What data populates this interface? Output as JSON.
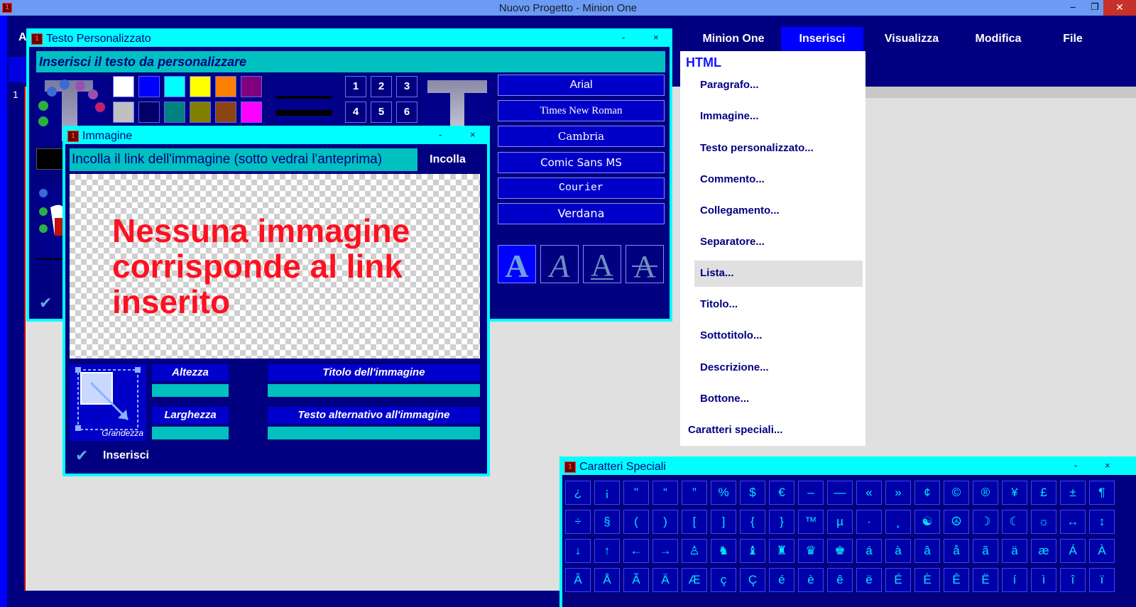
{
  "os_window": {
    "title": "Nuovo Progetto - Minion One",
    "icon_label": "1",
    "minimize": "–",
    "restore": "❐",
    "close": "✕"
  },
  "editor": {
    "top_letter": "A",
    "line_number": "1"
  },
  "menu": {
    "items": [
      "Minion One",
      "Inserisci",
      "Visualizza",
      "Modifica",
      "File"
    ],
    "active": "Inserisci"
  },
  "dropdown": {
    "header": "HTML",
    "items": [
      "Paragrafo...",
      "Immagine...",
      "Testo personalizzato...",
      "Commento...",
      "Collegamento...",
      "Separatore...",
      "Lista...",
      "Titolo...",
      "Sottotitolo...",
      "Descrizione...",
      "Bottone..."
    ],
    "footer": "Caratteri speciali...",
    "highlighted": "Lista..."
  },
  "testo_personalizzato": {
    "title": "Testo Personalizzato",
    "minimize": "-",
    "close": "×",
    "input_placeholder": "Inserisci il testo da personalizzare",
    "colors": [
      "#ffffff",
      "#0000ff",
      "#00ffff",
      "#ffff00",
      "#ff8000",
      "#800080",
      "#c0c0c0",
      "#000066",
      "#008080",
      "#808000",
      "#8b4513",
      "#ff00ff"
    ],
    "numbers": [
      "1",
      "2",
      "3",
      "4",
      "5",
      "6"
    ],
    "fonts": [
      "Arial",
      "Times New Roman",
      "Cambria",
      "Comic Sans MS",
      "Courier",
      "Verdana"
    ],
    "check": "✔"
  },
  "immagine": {
    "title": "Immagine",
    "minimize": "-",
    "close": "×",
    "link_placeholder": "Incolla il link dell'immagine (sotto vedrai l'anteprima)",
    "paste_button": "Incolla",
    "preview_message": "Nessuna immagine corrisponde al link inserito",
    "size_label": "Grandezza",
    "height_label": "Altezza",
    "width_label": "Larghezza",
    "image_title_label": "Titolo dell'immagine",
    "alt_text_label": "Testo alternativo all'immagine",
    "insert_label": "Inserisci",
    "check": "✔"
  },
  "caratteri_speciali": {
    "title": "Caratteri Speciali",
    "minimize": "-",
    "close": "×",
    "rows": [
      [
        "¿",
        "¡",
        "\"",
        "“",
        "”",
        "%",
        "$",
        "€",
        "–",
        "—",
        "«",
        "»",
        "¢",
        "©",
        "®",
        "¥",
        "£",
        "±",
        "¶"
      ],
      [
        "÷",
        "§",
        "(",
        ")",
        "[",
        "]",
        "{",
        "}",
        "™",
        "µ",
        "·",
        "¸",
        "☯",
        "☮",
        "☽",
        "☾",
        "☼",
        "↔",
        "↕"
      ],
      [
        "↓",
        "↑",
        "←",
        "→",
        "♙",
        "♞",
        "♝",
        "♜",
        "♛",
        "♚",
        "á",
        "à",
        "â",
        "å",
        "ã",
        "ä",
        "æ",
        "Á",
        "À"
      ],
      [
        "Â",
        "Å",
        "Ã",
        "Ä",
        "Æ",
        "ç",
        "Ç",
        "é",
        "è",
        "ê",
        "ë",
        "É",
        "È",
        "Ê",
        "Ë",
        "í",
        "ì",
        "î",
        "ï"
      ]
    ]
  }
}
